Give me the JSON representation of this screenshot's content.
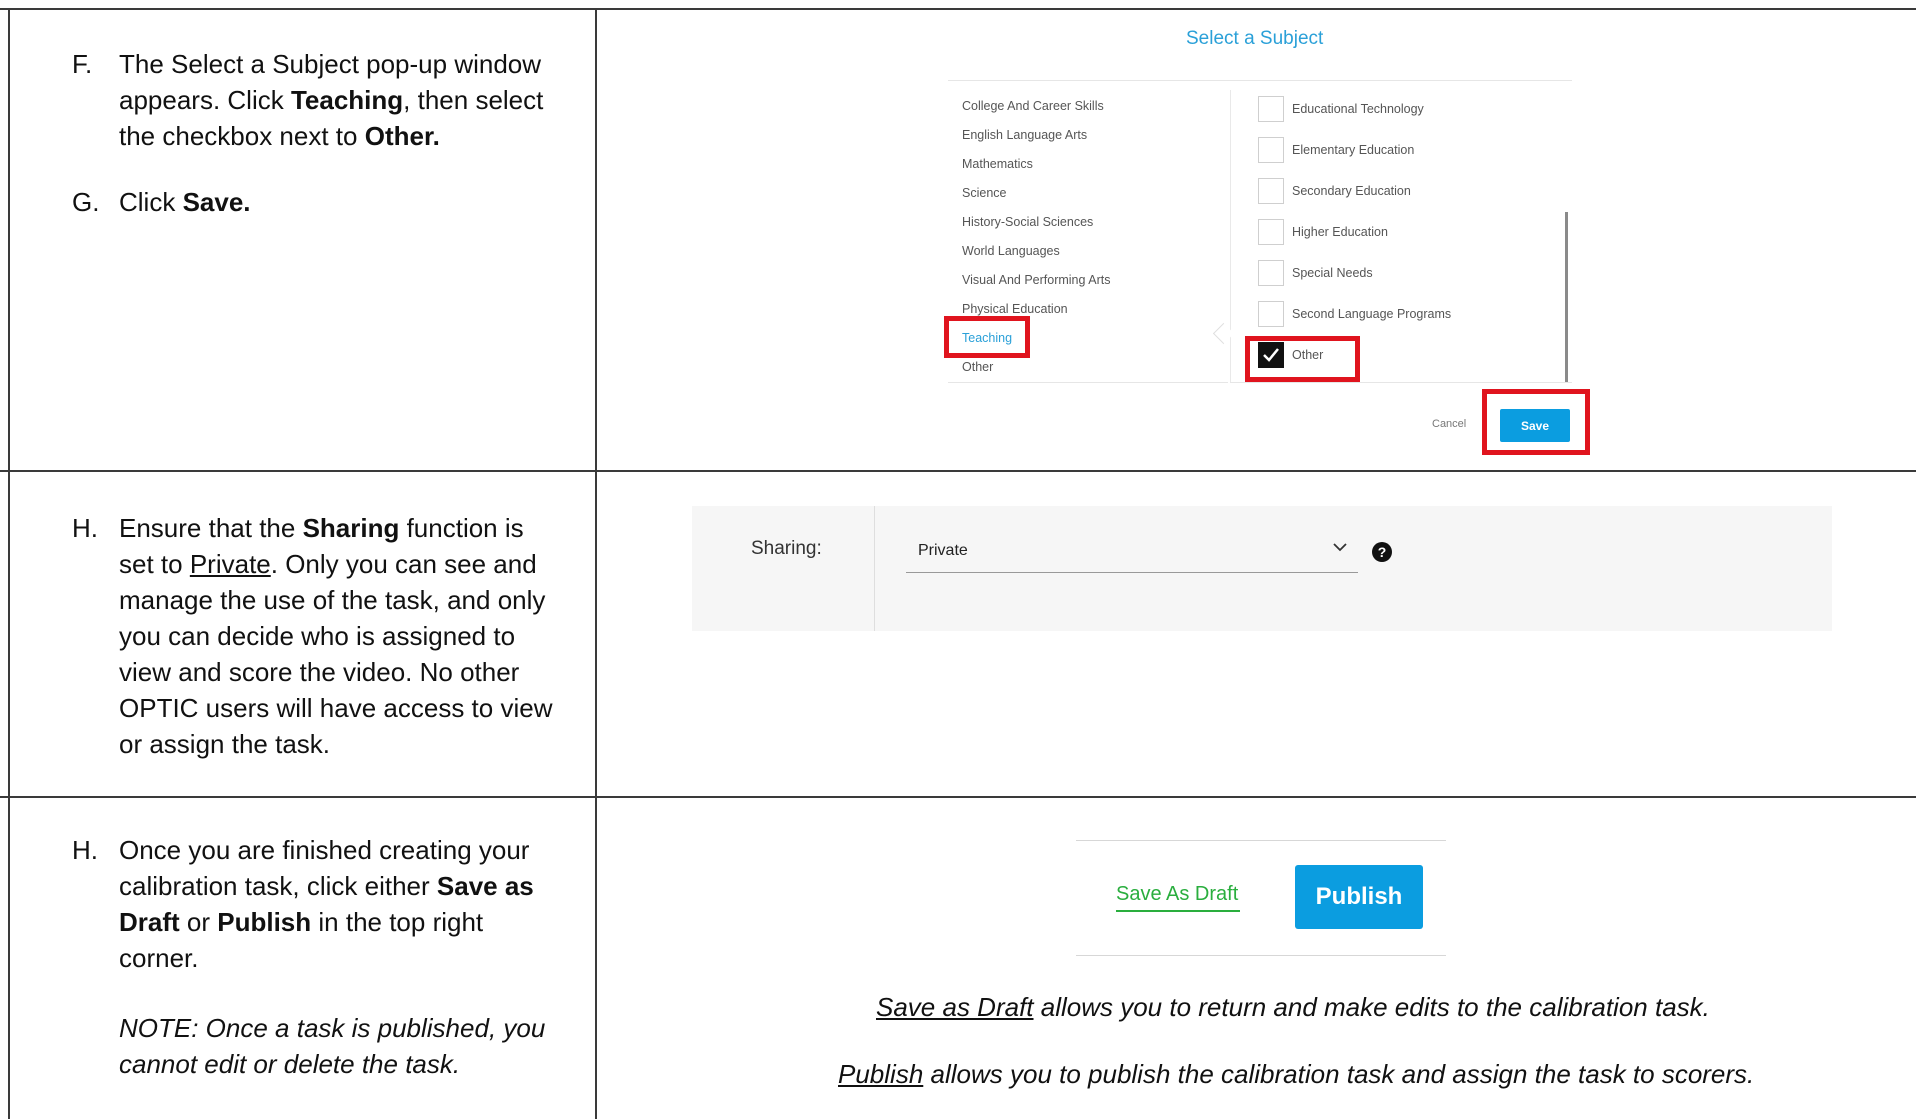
{
  "rows": [
    {
      "letter": "F.",
      "parts": [
        "The Select a Subject pop-up window appears. Click ",
        "Teaching",
        ", then select the checkbox next to ",
        "Other."
      ]
    },
    {
      "letter": "G.",
      "parts": [
        "Click ",
        "Save."
      ]
    },
    {
      "letter": "H.",
      "parts": [
        "Ensure that the ",
        "Sharing",
        " function is set to ",
        "Private",
        ". Only you can see and manage the use of the task, and only you can decide who is assigned to view and score the video. No other OPTIC users will have access to view or assign the task."
      ]
    },
    {
      "letter": "H.",
      "parts": [
        "Once you are finished creating your calibration task, click either ",
        "Save as Draft",
        " or ",
        "Publish",
        " in the top right corner."
      ],
      "note": "NOTE: Once a task is published, you cannot edit or delete the task."
    }
  ],
  "subject_popup": {
    "title": "Select a Subject",
    "subjects": [
      "College And Career Skills",
      "English Language Arts",
      "Mathematics",
      "Science",
      "History-Social Sciences",
      "World Languages",
      "Visual And Performing Arts",
      "Physical Education",
      "Teaching",
      "Other"
    ],
    "active_subject": "Teaching",
    "options": [
      {
        "label": "Educational Technology",
        "checked": false
      },
      {
        "label": "Elementary Education",
        "checked": false
      },
      {
        "label": "Secondary Education",
        "checked": false
      },
      {
        "label": "Higher Education",
        "checked": false
      },
      {
        "label": "Special Needs",
        "checked": false
      },
      {
        "label": "Second Language Programs",
        "checked": false
      },
      {
        "label": "Other",
        "checked": true
      }
    ],
    "cancel_label": "Cancel",
    "save_label": "Save",
    "highlight_color": "#e0141e",
    "accent_color": "#0b9de0"
  },
  "sharing": {
    "label": "Sharing:",
    "value": "Private",
    "chevron_icon": "chevron-down-icon",
    "help_icon": "question-circle-icon",
    "help_glyph": "?"
  },
  "publish_bar": {
    "draft_label": "Save As Draft",
    "publish_label": "Publish",
    "draft_color": "#2aae3e"
  },
  "notes": {
    "draft_term": "Save as Draft",
    "draft_rest": " allows you to return and make edits to the calibration task.",
    "publish_term": "Publish",
    "publish_rest": " allows you to publish the calibration task and assign the task to scorers."
  }
}
